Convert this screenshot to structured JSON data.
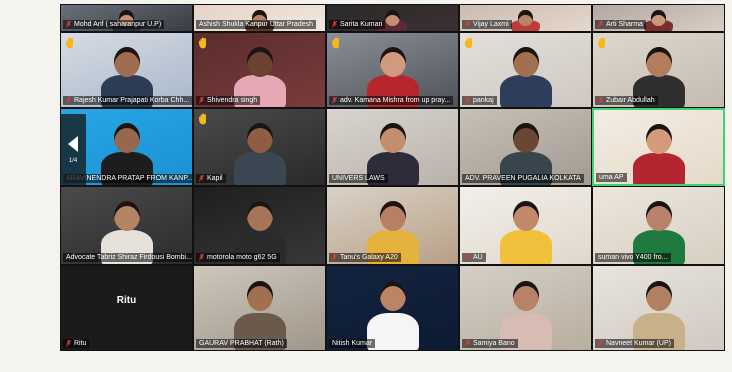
{
  "pager": {
    "page": "1/4"
  },
  "tiles": [
    {
      "name": "Mohd Arif ( saharanpur U.P)",
      "hand": false,
      "mic": true
    },
    {
      "name": "Ashish Shukla Kanpur Uttar Pradesh",
      "hand": false,
      "mic": false
    },
    {
      "name": "Sarita Kumari",
      "hand": false,
      "mic": true
    },
    {
      "name": "Vijay Laxmi",
      "hand": false,
      "mic": true
    },
    {
      "name": "Arti Sharma",
      "hand": false,
      "mic": true
    },
    {
      "name": "Rajesh Kumar Prajapati Korba Chh...",
      "hand": true,
      "mic": true
    },
    {
      "name": "Shivendra singh",
      "hand": true,
      "mic": true
    },
    {
      "name": "adv. Kamana Mishra from up pray...",
      "hand": true,
      "mic": true
    },
    {
      "name": "pankaj",
      "hand": true,
      "mic": true
    },
    {
      "name": "Zubair Abdullah",
      "hand": true,
      "mic": true
    },
    {
      "name": "ARAVINENDRA PRATAP FROM KANP...",
      "hand": false,
      "mic": false
    },
    {
      "name": "Kapil",
      "hand": true,
      "mic": true
    },
    {
      "name": "UNIVERS LAWS",
      "hand": false,
      "mic": false
    },
    {
      "name": "ADV. PRAVEEN PUGALIA KOLKATA",
      "hand": false,
      "mic": false
    },
    {
      "name": "uma AP",
      "hand": false,
      "mic": false
    },
    {
      "name": "Advocate Tabriz Shiraz Firdousi Bombi...",
      "hand": false,
      "mic": false
    },
    {
      "name": "motorola moto g62 5G",
      "hand": false,
      "mic": true
    },
    {
      "name": "Tanu's Galaxy A20",
      "hand": false,
      "mic": true
    },
    {
      "name": "AU",
      "hand": false,
      "mic": true
    },
    {
      "name": "suman vivo Y400 fro...",
      "hand": false,
      "mic": false
    },
    {
      "name": "Ritu",
      "hand": false,
      "mic": true,
      "label": "Ritu"
    },
    {
      "name": "GAURAV PRABHAT (Rath)",
      "hand": false,
      "mic": false
    },
    {
      "name": "Nitish Kumar",
      "hand": false,
      "mic": false
    },
    {
      "name": "Samiya Bano",
      "hand": false,
      "mic": true
    },
    {
      "name": "Navneet Kumar (UP)",
      "hand": false,
      "mic": true
    }
  ]
}
